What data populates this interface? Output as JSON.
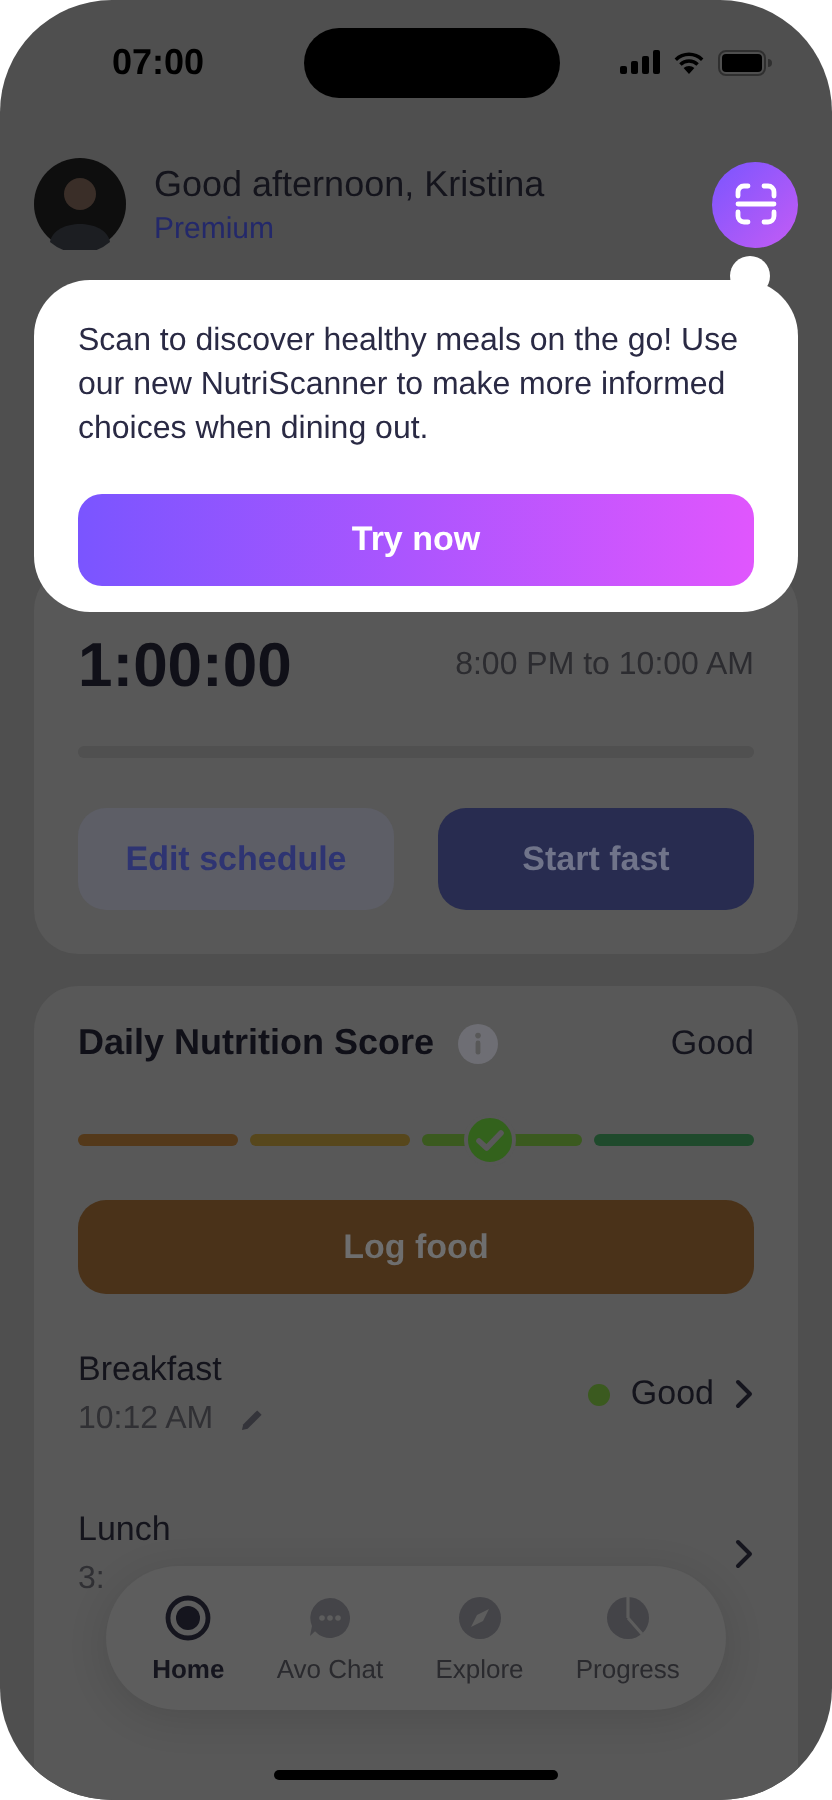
{
  "status_bar": {
    "time": "07:00"
  },
  "header": {
    "greeting": "Good afternoon, Kristina",
    "plan": "Premium"
  },
  "popup": {
    "message": "Scan to discover healthy meals on the go! Use our new NutriScanner to make more informed choices when dining out.",
    "button": "Try now"
  },
  "fasting": {
    "countdown": "1:00:00",
    "window": "8:00 PM to 10:00 AM",
    "buttons": [
      {
        "label": "Edit schedule",
        "kind": "secondary"
      },
      {
        "label": "Start fast",
        "kind": "primary"
      }
    ]
  },
  "nutrition": {
    "title": "Daily Nutrition Score",
    "rating": "Good",
    "score_bar": {
      "segments": [
        {
          "color": "#54391a"
        },
        {
          "color": "#57471c"
        },
        {
          "color": "#3b5a1f"
        },
        {
          "color": "#1f4a2c"
        }
      ]
    },
    "button": "Log food",
    "meals": [
      {
        "name": "Breakfast",
        "time": "10:12 AM",
        "rating": "Good",
        "color": "#3b5a1f"
      },
      {
        "name": "Lunch",
        "time": "3:"
      }
    ]
  },
  "tabs": [
    {
      "label": "Home",
      "selected": true
    },
    {
      "label": "Avo Chat",
      "selected": false
    },
    {
      "label": "Explore",
      "selected": false
    },
    {
      "label": "Progress",
      "selected": false
    }
  ]
}
